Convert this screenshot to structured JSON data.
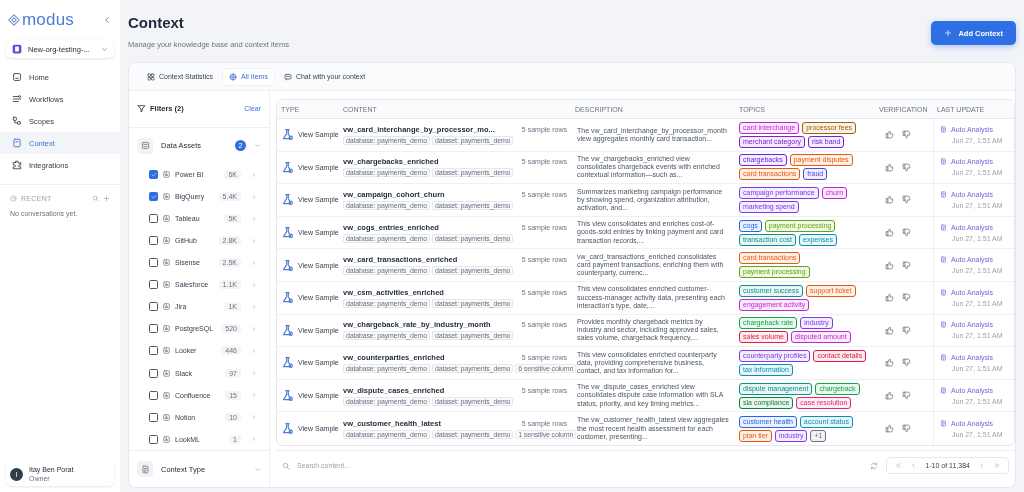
{
  "sidebar": {
    "logo": "modus",
    "org": "New-org-testing-...",
    "nav": [
      {
        "label": "Home",
        "selected": false
      },
      {
        "label": "Workflows",
        "selected": false
      },
      {
        "label": "Scopes",
        "selected": false
      },
      {
        "label": "Context",
        "selected": true
      },
      {
        "label": "Integrations",
        "selected": false
      }
    ],
    "recent_heading": "RECENT",
    "recent_empty": "No conversations yet.",
    "user": {
      "initial": "I",
      "name": "Itay Ben Porat",
      "role": "Owner"
    }
  },
  "header": {
    "title": "Context",
    "subtitle": "Manage your knowledge base and context items",
    "add_button": "Add Context"
  },
  "tabs": [
    {
      "label": "Context Statistics",
      "selected": false
    },
    {
      "label": "All Items",
      "selected": true
    },
    {
      "label": "Chat with your context",
      "selected": false
    }
  ],
  "filters": {
    "title": "Filters (2)",
    "clear": "Clear",
    "groups": [
      {
        "label": "Data Assets",
        "badge": "2",
        "items": [
          {
            "name": "Power BI",
            "count": "6K",
            "checked": true
          },
          {
            "name": "BigQuery",
            "count": "5.4K",
            "checked": true
          },
          {
            "name": "Tableau",
            "count": "5K",
            "checked": false
          },
          {
            "name": "GitHub",
            "count": "2.8K",
            "checked": false
          },
          {
            "name": "Sisense",
            "count": "2.5K",
            "checked": false
          },
          {
            "name": "Salesforce",
            "count": "1.1K",
            "checked": false
          },
          {
            "name": "Jira",
            "count": "1K",
            "checked": false
          },
          {
            "name": "PostgreSQL",
            "count": "520",
            "checked": false
          },
          {
            "name": "Looker",
            "count": "446",
            "checked": false
          },
          {
            "name": "Slack",
            "count": "97",
            "checked": false
          },
          {
            "name": "Confluence",
            "count": "15",
            "checked": false
          },
          {
            "name": "Notion",
            "count": "10",
            "checked": false
          },
          {
            "name": "LookML",
            "count": "1",
            "checked": false
          }
        ]
      },
      {
        "label": "Context Type"
      }
    ]
  },
  "table": {
    "columns": [
      "TYPE",
      "CONTENT",
      "DESCRIPTION",
      "TOPICS",
      "VERIFICATION",
      "LAST UPDATE"
    ],
    "rows": [
      {
        "type": "View Sample",
        "name": "vw_card_interchange_by_processor_mo...",
        "samples": "5 sample rows",
        "chips": [
          "database: payments_demo",
          "dataset: payments_demo"
        ],
        "description": "The vw_card_interchange_by_processor_month view aggregates monthly card transaction...",
        "topics": [
          {
            "label": "card interchange",
            "color": "#c026d3"
          },
          {
            "label": "processor fees",
            "color": "#a16207"
          },
          {
            "label": "merchant category",
            "color": "#7e22ce"
          },
          {
            "label": "risk band",
            "color": "#6d28d9"
          }
        ],
        "update": "Auto Analysis",
        "time": "Jun 27, 1:51 AM"
      },
      {
        "type": "View Sample",
        "name": "vw_chargebacks_enriched",
        "samples": "5 sample rows",
        "chips": [
          "database: payments_demo",
          "dataset: payments_demo"
        ],
        "description": "The vw_chargebacks_enriched view consolidates chargeback events with enriched contextual information—such as...",
        "topics": [
          {
            "label": "chargebacks",
            "color": "#6d28d9"
          },
          {
            "label": "payment disputes",
            "color": "#ea580c"
          },
          {
            "label": "card transactions",
            "color": "#ea580c"
          },
          {
            "label": "fraud",
            "color": "#4f46e5"
          }
        ],
        "update": "Auto Analysis",
        "time": "Jun 27, 1:51 AM"
      },
      {
        "type": "View Sample",
        "name": "vw_campaign_cohort_churn",
        "samples": "5 sample rows",
        "chips": [
          "database: payments_demo",
          "dataset: payments_demo"
        ],
        "description": "Summarizes marketing campaign performance by showing spend, organization attribution, activation, and...",
        "topics": [
          {
            "label": "campaign performance",
            "color": "#7c3aed"
          },
          {
            "label": "churn",
            "color": "#c026d3"
          },
          {
            "label": "marketing spend",
            "color": "#7c3aed"
          }
        ],
        "update": "Auto Analysis",
        "time": "Jun 27, 1:51 AM"
      },
      {
        "type": "View Sample",
        "name": "vw_cogs_entries_enriched",
        "samples": "5 sample rows",
        "chips": [
          "database: payments_demo",
          "dataset: payments_demo"
        ],
        "description": "This view consolidates and enriches cost-of-goods-sold entries by linking payment and card transaction records,...",
        "topics": [
          {
            "label": "cogs",
            "color": "#2563eb"
          },
          {
            "label": "payment processing",
            "color": "#65a30d"
          },
          {
            "label": "transaction cost",
            "color": "#0d9488"
          },
          {
            "label": "expenses",
            "color": "#0891b2"
          }
        ],
        "update": "Auto Analysis",
        "time": "Jun 27, 1:51 AM"
      },
      {
        "type": "View Sample",
        "name": "vw_card_transactions_enriched",
        "samples": "5 sample rows",
        "chips": [
          "database: payments_demo",
          "dataset: payments_demo"
        ],
        "description": "vw_card_transactions_enriched consolidates card payment transactions, enriching them with counterparty, currenc...",
        "topics": [
          {
            "label": "card transactions",
            "color": "#ea580c"
          },
          {
            "label": "payment processing",
            "color": "#65a30d"
          }
        ],
        "update": "Auto Analysis",
        "time": "Jun 27, 1:51 AM"
      },
      {
        "type": "View Sample",
        "name": "vw_csm_activities_enriched",
        "samples": "5 sample rows",
        "chips": [
          "database: payments_demo",
          "dataset: payments_demo"
        ],
        "description": "This view consolidates enriched customer-success-manager activity data, presenting each interaction's type, date,...",
        "topics": [
          {
            "label": "customer success",
            "color": "#0d9488"
          },
          {
            "label": "support ticket",
            "color": "#ea580c"
          },
          {
            "label": "engagement activity",
            "color": "#c026d3"
          }
        ],
        "update": "Auto Analysis",
        "time": "Jun 27, 1:51 AM"
      },
      {
        "type": "View Sample",
        "name": "vw_chargeback_rate_by_industry_month",
        "samples": "5 sample rows",
        "chips": [
          "database: payments_demo",
          "dataset: payments_demo"
        ],
        "description": "Provides monthly chargeback metrics by industry and sector, including approved sales, sales volume, chargeback frequency,...",
        "topics": [
          {
            "label": "chargeback rate",
            "color": "#16a34a"
          },
          {
            "label": "industry",
            "color": "#7c3aed"
          },
          {
            "label": "sales volume",
            "color": "#e11d48"
          },
          {
            "label": "disputed amount",
            "color": "#c026d3"
          }
        ],
        "update": "Auto Analysis",
        "time": "Jun 27, 1:51 AM"
      },
      {
        "type": "View Sample",
        "name": "vw_counterparties_enriched",
        "samples": "5 sample rows",
        "chips": [
          "database: payments_demo",
          "dataset: payments_demo",
          "6 sensitive column"
        ],
        "description": "This view consolidates enriched counterparty data, providing comprehensive business, contact, and tax information for...",
        "topics": [
          {
            "label": "counterparty profiles",
            "color": "#7c3aed"
          },
          {
            "label": "contact details",
            "color": "#e11d48"
          },
          {
            "label": "tax information",
            "color": "#0891b2"
          }
        ],
        "update": "Auto Analysis",
        "time": "Jun 27, 1:51 AM"
      },
      {
        "type": "View Sample",
        "name": "vw_dispute_cases_enriched",
        "samples": "5 sample rows",
        "chips": [
          "database: payments_demo",
          "dataset: payments_demo"
        ],
        "description": "The vw_dispute_cases_enriched view consolidates dispute case information with SLA status, priority, and key timing metrics...",
        "topics": [
          {
            "label": "dispute management",
            "color": "#0d9488"
          },
          {
            "label": "chargeback",
            "color": "#16a34a"
          },
          {
            "label": "sla compliance",
            "color": "#15803d"
          },
          {
            "label": "case resolution",
            "color": "#db2777"
          }
        ],
        "update": "Auto Analysis",
        "time": "Jun 27, 1:51 AM"
      },
      {
        "type": "View Sample",
        "name": "vw_customer_health_latest",
        "samples": "5 sample rows",
        "chips": [
          "database: payments_demo",
          "dataset: payments_demo",
          "1 sensitive column"
        ],
        "description": "The vw_customer_health_latest view aggregates the most recent health assessment for each customer, presenting...",
        "topics": [
          {
            "label": "customer health",
            "color": "#2563eb"
          },
          {
            "label": "account status",
            "color": "#0891b2"
          },
          {
            "label": "plan tier",
            "color": "#ea580c"
          },
          {
            "label": "industry",
            "color": "#7c3aed"
          },
          {
            "label": "+1",
            "color": "#6b7280"
          }
        ],
        "update": "Auto Analysis",
        "time": "Jun 27, 1:51 AM"
      }
    ]
  },
  "footer": {
    "search_placeholder": "Search content...",
    "range": "1-10 of 11,384"
  }
}
